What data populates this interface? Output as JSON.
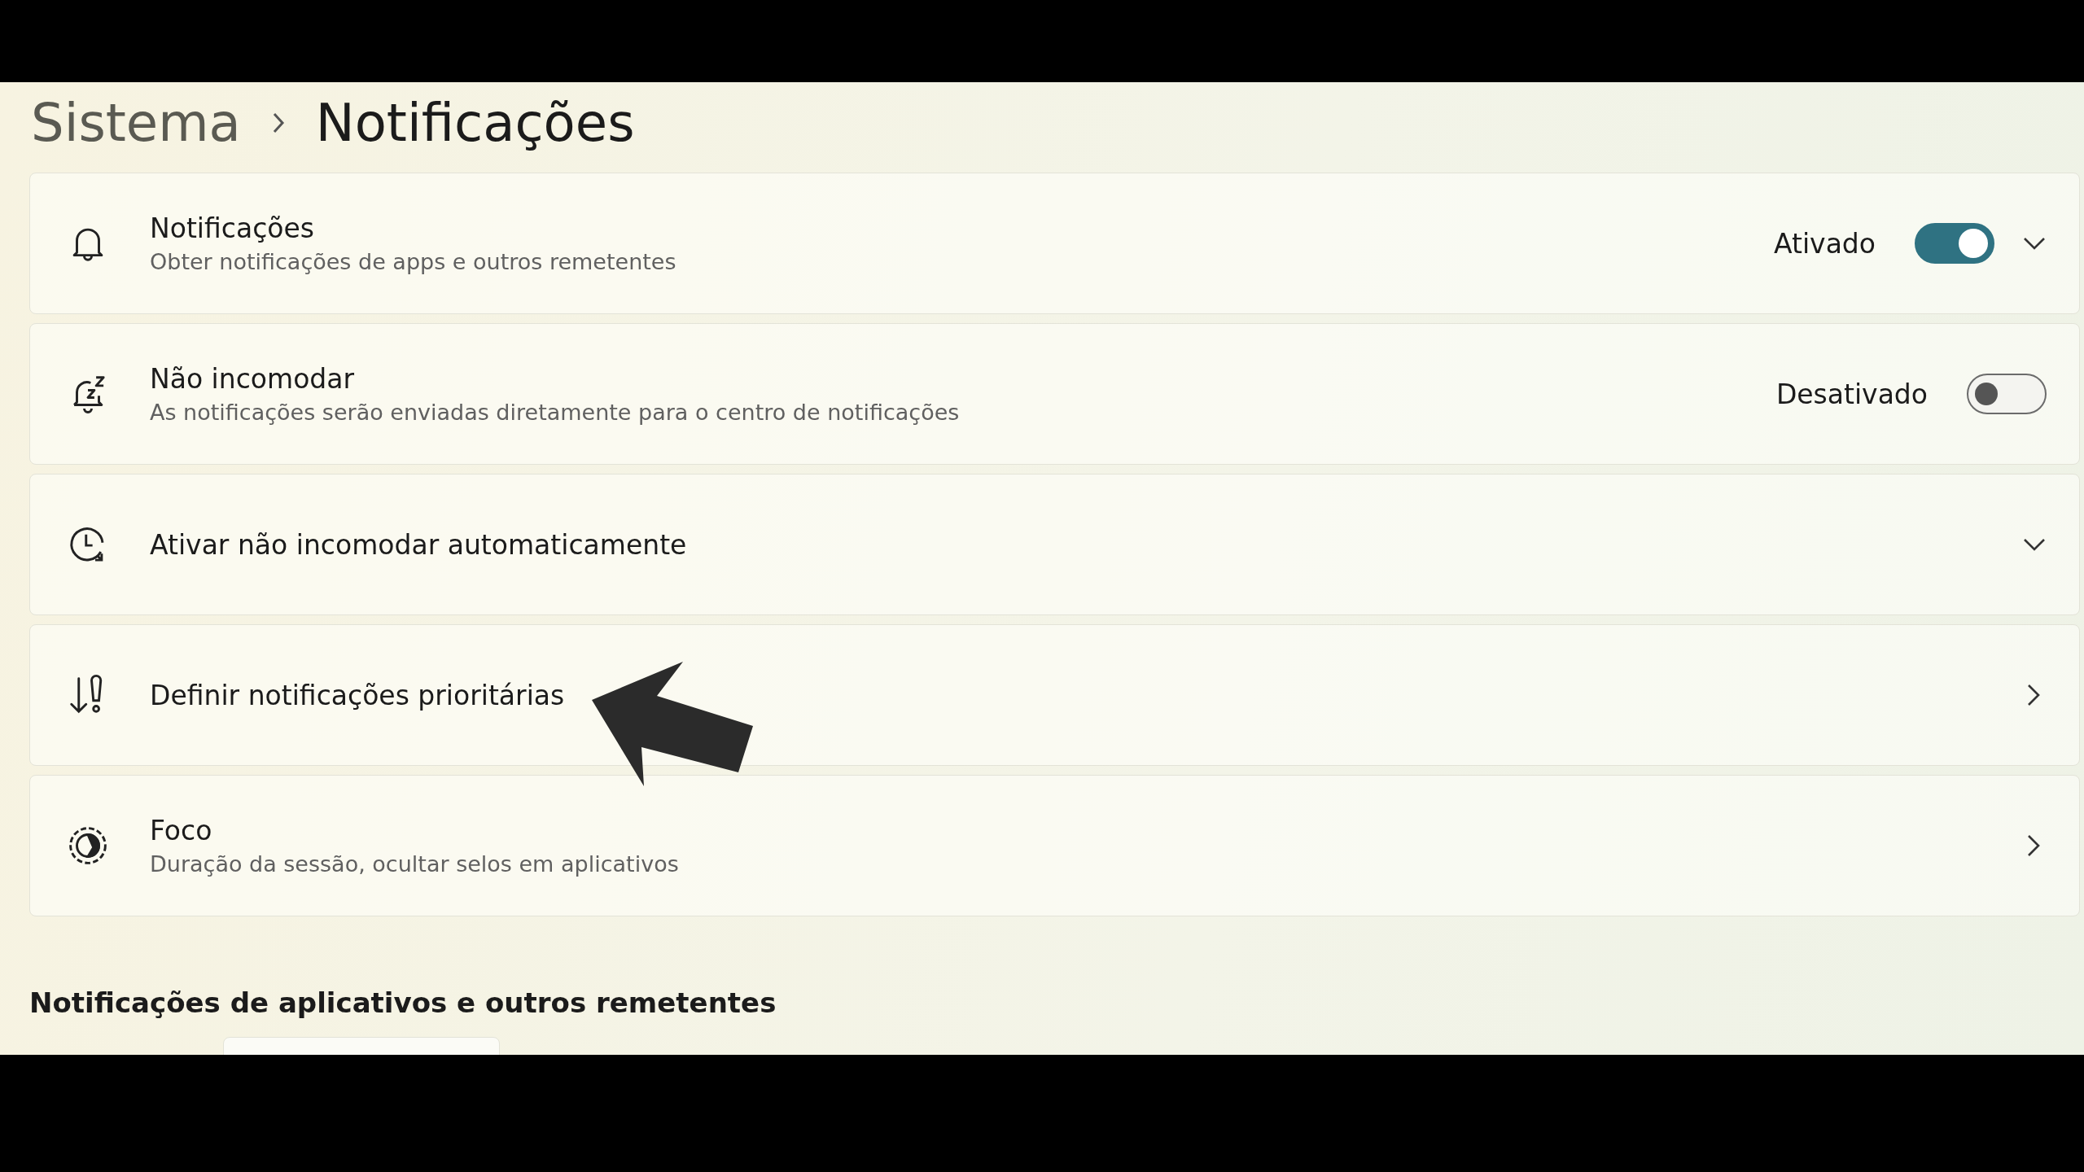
{
  "breadcrumb": [
    {
      "label": "Sistema",
      "current": false
    },
    {
      "label": "Notificações",
      "current": true
    }
  ],
  "settings": [
    {
      "kind": "toggle",
      "title": "Notificações",
      "subtitle": "Obter notificações de apps e outros remetentes",
      "status": "Ativado",
      "on": true,
      "expandable": true
    },
    {
      "kind": "toggle",
      "title": "Não incomodar",
      "subtitle": "As notificações serão enviadas diretamente para o centro de notificações",
      "status": "Desativado",
      "on": false,
      "expandable": false
    },
    {
      "kind": "expander",
      "title": "Ativar não incomodar automaticamente"
    },
    {
      "kind": "link",
      "title": "Definir notificações prioritárias"
    },
    {
      "kind": "link",
      "title": "Foco",
      "subtitle": "Duração da sessão, ocultar selos em aplicativos"
    }
  ],
  "section_heading": "Notificações de aplicativos e outros remetentes"
}
